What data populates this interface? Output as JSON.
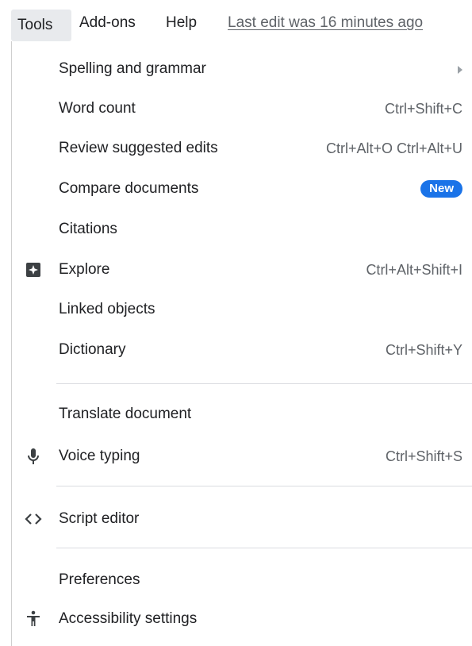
{
  "menubar": {
    "tools": "Tools",
    "addons": "Add-ons",
    "help": "Help",
    "last_edit": "Last edit was 16 minutes ago"
  },
  "menu": {
    "spelling": {
      "label": "Spelling and grammar"
    },
    "word_count": {
      "label": "Word count",
      "shortcut": "Ctrl+Shift+C"
    },
    "review": {
      "label": "Review suggested edits",
      "shortcut": "Ctrl+Alt+O Ctrl+Alt+U"
    },
    "compare": {
      "label": "Compare documents",
      "badge": "New"
    },
    "citations": {
      "label": "Citations"
    },
    "explore": {
      "label": "Explore",
      "shortcut": "Ctrl+Alt+Shift+I",
      "icon": "explore-icon"
    },
    "linked": {
      "label": "Linked objects"
    },
    "dictionary": {
      "label": "Dictionary",
      "shortcut": "Ctrl+Shift+Y"
    },
    "translate": {
      "label": "Translate document"
    },
    "voice": {
      "label": "Voice typing",
      "shortcut": "Ctrl+Shift+S",
      "icon": "microphone-icon"
    },
    "script": {
      "label": "Script editor",
      "icon": "code-icon"
    },
    "preferences": {
      "label": "Preferences"
    },
    "accessibility": {
      "label": "Accessibility settings",
      "icon": "accessibility-icon"
    }
  },
  "colors": {
    "badge": "#1a73e8",
    "icon": "#3c4043",
    "shortcut_text": "#5f6368"
  }
}
